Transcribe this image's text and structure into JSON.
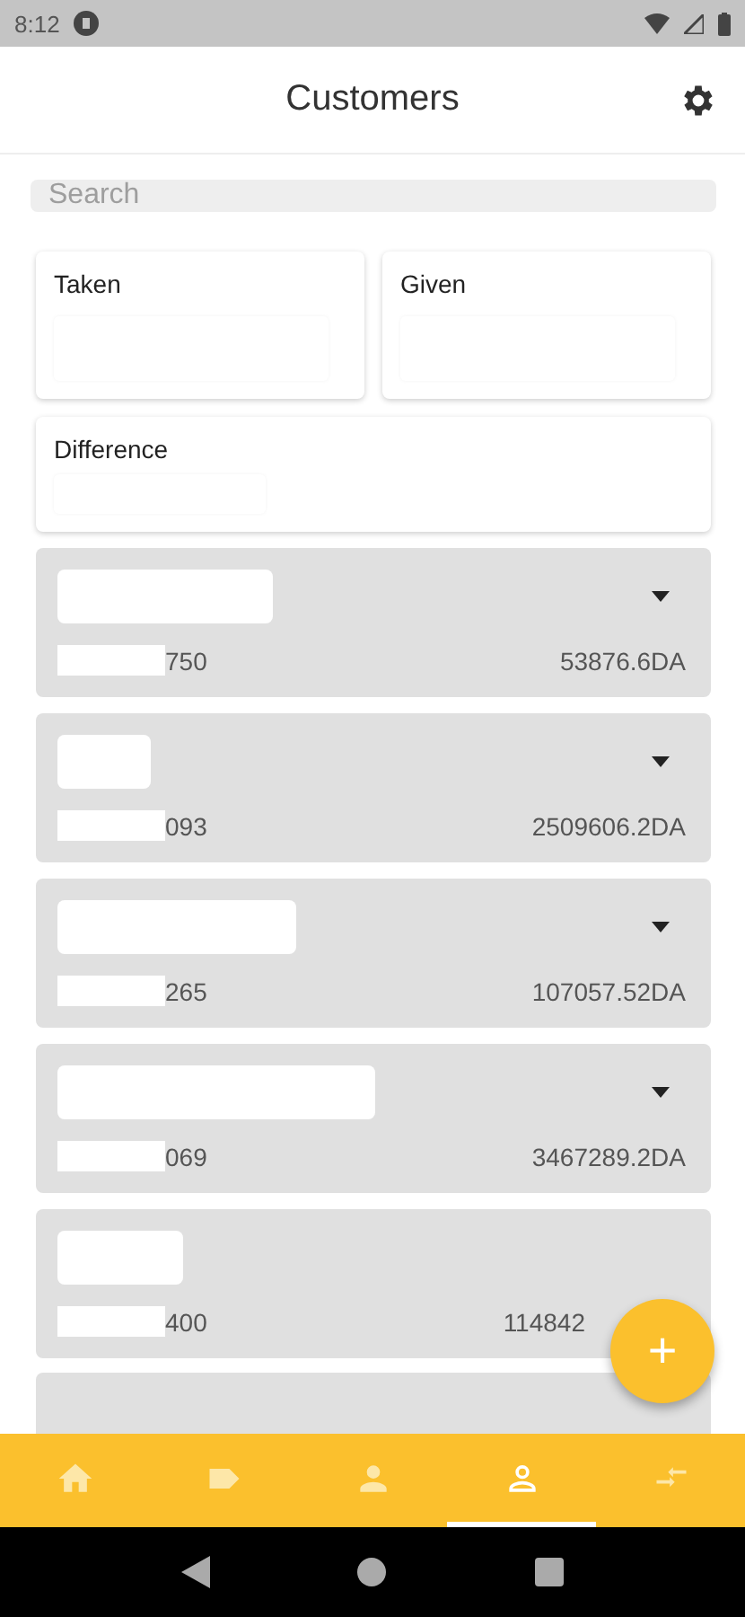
{
  "status_bar": {
    "time": "8:12"
  },
  "app_bar": {
    "title": "Customers"
  },
  "search": {
    "placeholder": "Search"
  },
  "totals": [
    {
      "label": "Taken"
    },
    {
      "label": "Given"
    }
  ],
  "difference": {
    "label": "Difference"
  },
  "customers": [
    {
      "phone_suffix": "750",
      "amount": "53876.6DA",
      "caret": true
    },
    {
      "phone_suffix": "093",
      "amount": "2509606.2DA",
      "caret": true
    },
    {
      "phone_suffix": "265",
      "amount": "107057.52DA",
      "caret": true
    },
    {
      "phone_suffix": "069",
      "amount": "3467289.2DA",
      "caret": true
    },
    {
      "phone_suffix": "400",
      "amount": "114842",
      "caret": false
    }
  ],
  "fab": {
    "label": "+"
  },
  "bottom_nav": [
    {
      "kind": "home",
      "selected": false
    },
    {
      "kind": "tag",
      "selected": false
    },
    {
      "kind": "person",
      "selected": false
    },
    {
      "kind": "person-outline",
      "selected": true
    },
    {
      "kind": "swap",
      "selected": false
    }
  ]
}
